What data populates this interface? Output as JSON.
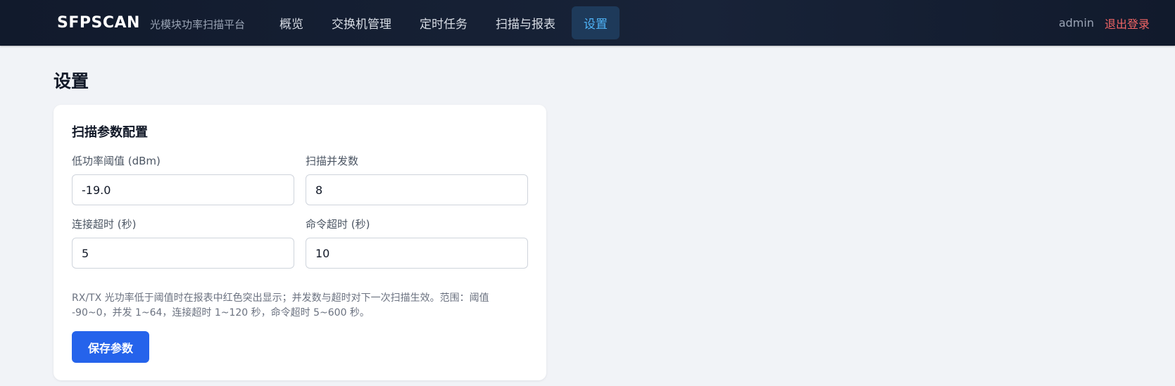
{
  "header": {
    "brand_name": "SFPSCAN",
    "brand_subtitle": "光模块功率扫描平台",
    "nav": [
      {
        "label": "概览",
        "active": false
      },
      {
        "label": "交换机管理",
        "active": false
      },
      {
        "label": "定时任务",
        "active": false
      },
      {
        "label": "扫描与报表",
        "active": false
      },
      {
        "label": "设置",
        "active": true
      }
    ],
    "username": "admin",
    "logout_label": "退出登录"
  },
  "page": {
    "title": "设置"
  },
  "scan_params": {
    "title": "扫描参数配置",
    "fields": [
      {
        "label": "低功率阈值 (dBm)",
        "value": "-19.0"
      },
      {
        "label": "扫描并发数",
        "value": "8"
      },
      {
        "label": "连接超时 (秒)",
        "value": "5"
      },
      {
        "label": "命令超时 (秒)",
        "value": "10"
      }
    ],
    "hint": "RX/TX 光功率低于阈值时在报表中红色突出显示；并发数与超时对下一次扫描生效。范围：阈值 -90~0，并发 1~64，连接超时 1~120 秒，命令超时 5~600 秒。",
    "save_label": "保存参数"
  },
  "colors": {
    "header_bg": "#141d30",
    "active_nav_bg": "#1e3a5a",
    "active_nav_text": "#4fb3f7",
    "logout": "#f26565",
    "primary_button": "#2563eb",
    "page_bg": "#f1f3f7"
  }
}
